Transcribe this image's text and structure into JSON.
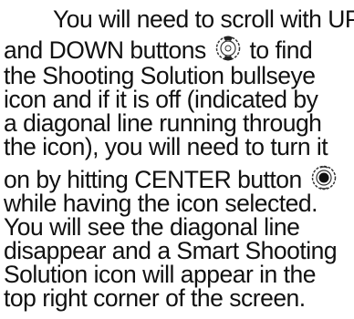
{
  "text": {
    "l1": "You will need to scroll with UP",
    "l2a": "and DOWN buttons",
    "l2b": "to find",
    "l3": "the Shooting Solution bullseye",
    "l4": "icon and if it is off (indicated by",
    "l5": "a diagonal line running through",
    "l6": "the icon), you will need to turn it",
    "l7": "on by hitting CENTER button",
    "l8": "while having the icon selected.",
    "l9": "You will see the diagonal line",
    "l10": "disappear and a Smart Shooting",
    "l11": "Solution icon will appear in the",
    "l12": "top right corner of the screen."
  },
  "icons": {
    "updown": "up-down-buttons-icon",
    "center": "center-button-icon"
  }
}
